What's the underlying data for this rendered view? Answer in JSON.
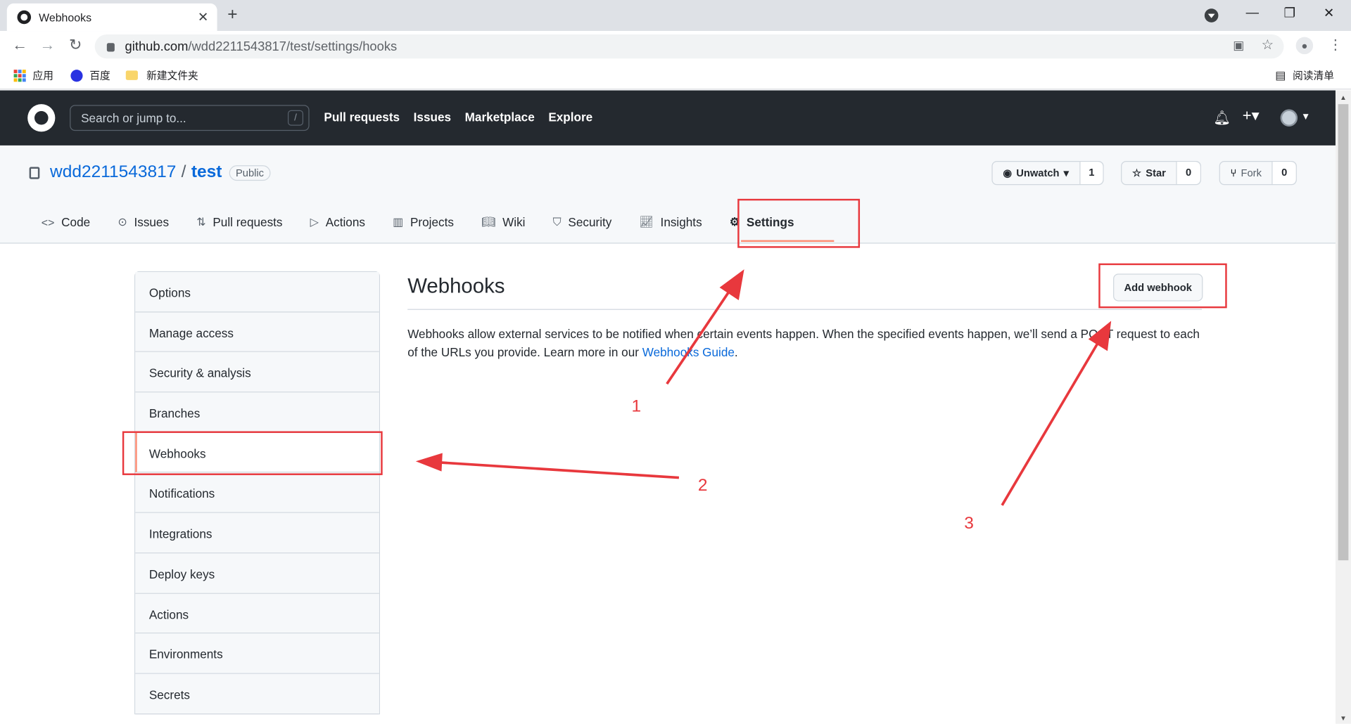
{
  "browser": {
    "tab_title": "Webhooks",
    "url_host": "github.com",
    "url_path": "/wdd2211543817/test/settings/hooks",
    "bookmarks": [
      {
        "label": "应用"
      },
      {
        "label": "百度"
      },
      {
        "label": "新建文件夹"
      }
    ],
    "reading_list": "阅读清单"
  },
  "github": {
    "search_placeholder": "Search or jump to...",
    "search_key": "/",
    "nav": [
      "Pull requests",
      "Issues",
      "Marketplace",
      "Explore"
    ]
  },
  "repo": {
    "owner": "wdd2211543817",
    "separator": "/",
    "name": "test",
    "visibility": "Public",
    "unwatch_label": "Unwatch",
    "unwatch_count": "1",
    "star_label": "Star",
    "star_count": "0",
    "fork_label": "Fork",
    "fork_count": "0",
    "tabs": [
      "Code",
      "Issues",
      "Pull requests",
      "Actions",
      "Projects",
      "Wiki",
      "Security",
      "Insights",
      "Settings"
    ],
    "selected_tab": "Settings"
  },
  "sidebar": {
    "items": [
      "Options",
      "Manage access",
      "Security & analysis",
      "Branches",
      "Webhooks",
      "Notifications",
      "Integrations",
      "Deploy keys",
      "Actions",
      "Environments",
      "Secrets"
    ],
    "selected": "Webhooks"
  },
  "main": {
    "title": "Webhooks",
    "add_button": "Add webhook",
    "desc_text": "Webhooks allow external services to be notified when certain events happen. When the specified events happen, we’ll send a POST request to each of the URLs you provide. Learn more in our ",
    "desc_link": "Webhooks Guide",
    "desc_end": "."
  },
  "annotations": {
    "labels": [
      "1",
      "2",
      "3"
    ],
    "color": "#e8383d"
  }
}
